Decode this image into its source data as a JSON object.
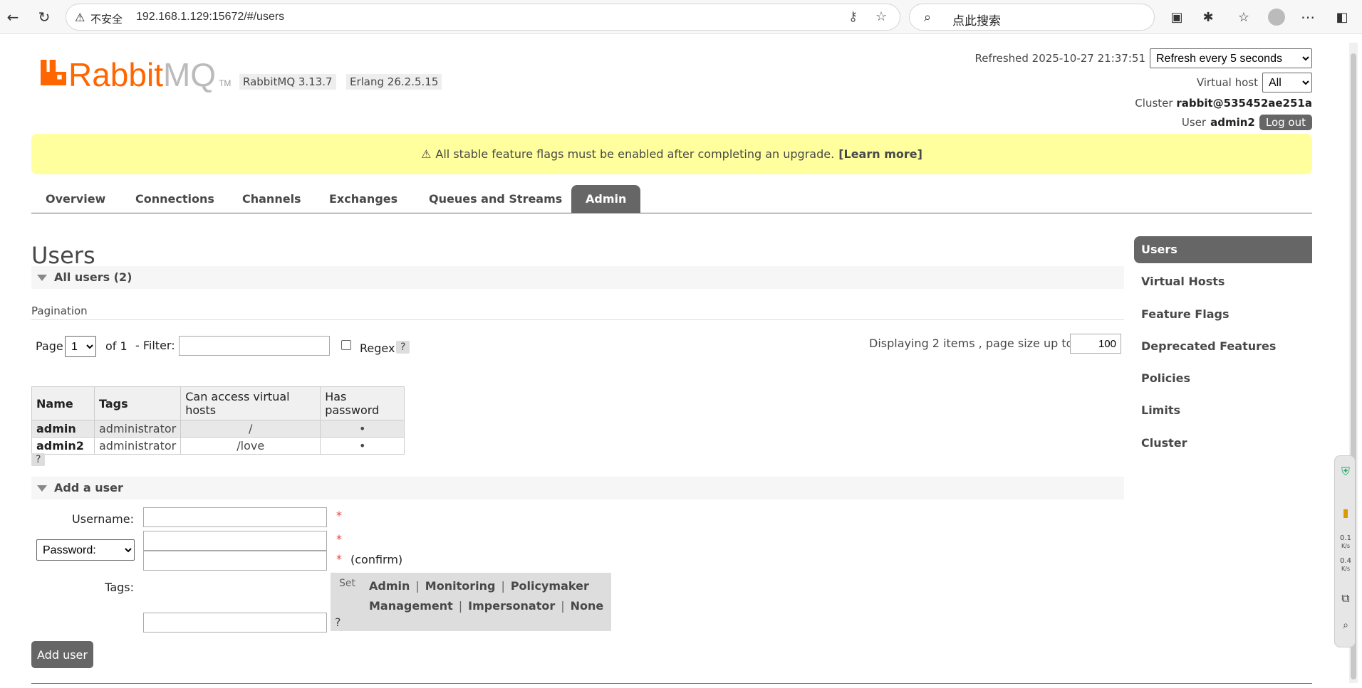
{
  "browser": {
    "insecure_label": "不安全",
    "url": "192.168.1.129:15672/#/users",
    "search_placeholder": "点此搜索"
  },
  "header": {
    "logo_rabbit": "Rabbit",
    "logo_mq": "MQ",
    "logo_tm": "TM",
    "rabbitmq_version": "RabbitMQ 3.13.7",
    "erlang_version": "Erlang 26.2.5.15",
    "refreshed_label": "Refreshed 2025-10-27 21:37:51",
    "refresh_option": "Refresh every 5 seconds",
    "vhost_label": "Virtual host",
    "vhost_value": "All",
    "cluster_label": "Cluster",
    "cluster_value": "rabbit@535452ae251a",
    "user_label": "User",
    "user_value": "admin2",
    "logout_label": "Log out"
  },
  "banner": {
    "icon": "⚠",
    "text": "All stable feature flags must be enabled after completing an upgrade.",
    "link": "[Learn more]"
  },
  "tabs": [
    "Overview",
    "Connections",
    "Channels",
    "Exchanges",
    "Queues and Streams",
    "Admin"
  ],
  "active_tab": "Admin",
  "page_title": "Users",
  "all_users_label": "All users (2)",
  "pagination": {
    "section_label": "Pagination",
    "page_label": "Page",
    "page_value": "1",
    "of_label": "of 1",
    "filter_label": "- Filter:",
    "regex_label": "Regex",
    "help": "?",
    "displaying_label": "Displaying 2 items , page size up to:",
    "page_size": "100"
  },
  "users_table": {
    "columns": [
      "Name",
      "Tags",
      "Can access virtual hosts",
      "Has password"
    ],
    "rows": [
      {
        "name": "admin",
        "tags": "administrator",
        "vhosts": "/",
        "has_password": "•"
      },
      {
        "name": "admin2",
        "tags": "administrator",
        "vhosts": "/love",
        "has_password": "•"
      }
    ],
    "help": "?"
  },
  "add_user": {
    "section_label": "Add a user",
    "username_label": "Username:",
    "password_option": "Password:",
    "required": "*",
    "confirm_label": "(confirm)",
    "tags_label": "Tags:",
    "set_label": "Set",
    "tag_options_row1": [
      "Admin",
      "Monitoring",
      "Policymaker"
    ],
    "tag_options_row2": [
      "Management",
      "Impersonator",
      "None"
    ],
    "separator": "|",
    "help": "?",
    "submit_label": "Add user"
  },
  "sidebar": [
    "Users",
    "Virtual Hosts",
    "Feature Flags",
    "Deprecated Features",
    "Policies",
    "Limits",
    "Cluster"
  ],
  "sidebar_active": "Users",
  "widget": {
    "up": "0.1",
    "down": "0.4",
    "unit": "K/s"
  }
}
